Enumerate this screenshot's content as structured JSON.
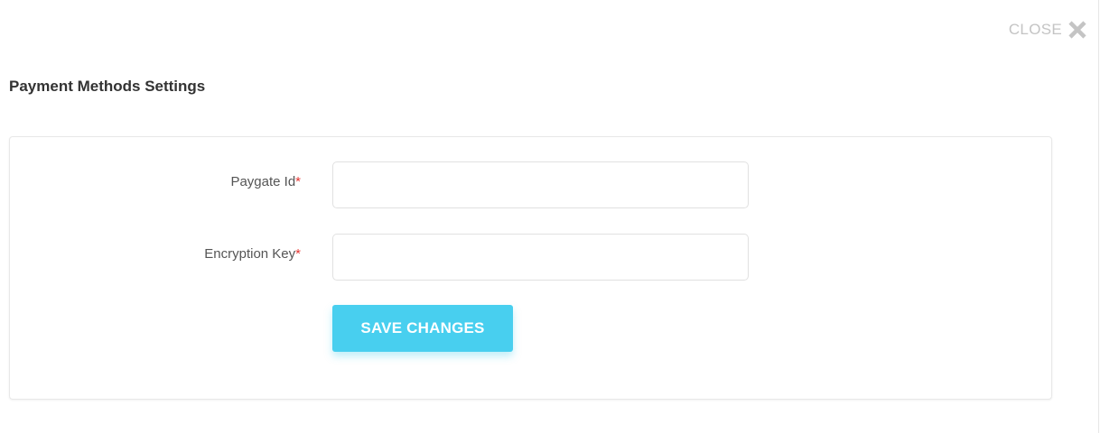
{
  "header": {
    "close_label": "CLOSE",
    "close_icon": "close-icon"
  },
  "page": {
    "title": "Payment Methods Settings"
  },
  "form": {
    "fields": [
      {
        "label": "Paygate Id",
        "required_mark": "*",
        "value": "",
        "placeholder": ""
      },
      {
        "label": "Encryption Key",
        "required_mark": "*",
        "value": "",
        "placeholder": ""
      }
    ],
    "save_label": "SAVE CHANGES"
  },
  "colors": {
    "accent": "#48cfef",
    "required": "#e53935",
    "close": "#c4c4c4"
  }
}
